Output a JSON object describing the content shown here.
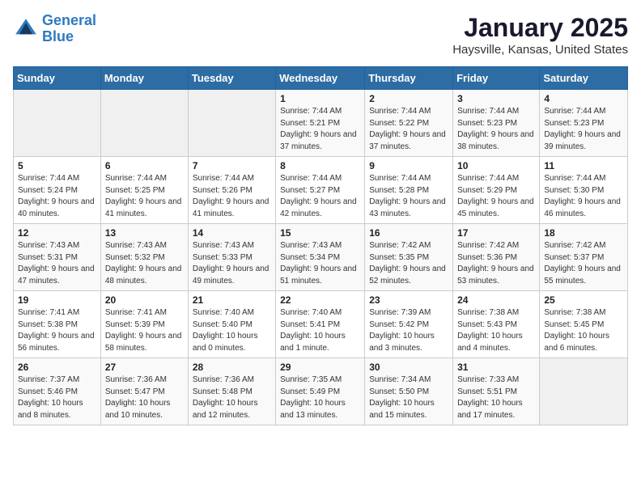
{
  "header": {
    "logo_line1": "General",
    "logo_line2": "Blue",
    "title": "January 2025",
    "subtitle": "Haysville, Kansas, United States"
  },
  "weekdays": [
    "Sunday",
    "Monday",
    "Tuesday",
    "Wednesday",
    "Thursday",
    "Friday",
    "Saturday"
  ],
  "weeks": [
    [
      {
        "day": "",
        "info": ""
      },
      {
        "day": "",
        "info": ""
      },
      {
        "day": "",
        "info": ""
      },
      {
        "day": "1",
        "info": "Sunrise: 7:44 AM\nSunset: 5:21 PM\nDaylight: 9 hours and 37 minutes."
      },
      {
        "day": "2",
        "info": "Sunrise: 7:44 AM\nSunset: 5:22 PM\nDaylight: 9 hours and 37 minutes."
      },
      {
        "day": "3",
        "info": "Sunrise: 7:44 AM\nSunset: 5:23 PM\nDaylight: 9 hours and 38 minutes."
      },
      {
        "day": "4",
        "info": "Sunrise: 7:44 AM\nSunset: 5:23 PM\nDaylight: 9 hours and 39 minutes."
      }
    ],
    [
      {
        "day": "5",
        "info": "Sunrise: 7:44 AM\nSunset: 5:24 PM\nDaylight: 9 hours and 40 minutes."
      },
      {
        "day": "6",
        "info": "Sunrise: 7:44 AM\nSunset: 5:25 PM\nDaylight: 9 hours and 41 minutes."
      },
      {
        "day": "7",
        "info": "Sunrise: 7:44 AM\nSunset: 5:26 PM\nDaylight: 9 hours and 41 minutes."
      },
      {
        "day": "8",
        "info": "Sunrise: 7:44 AM\nSunset: 5:27 PM\nDaylight: 9 hours and 42 minutes."
      },
      {
        "day": "9",
        "info": "Sunrise: 7:44 AM\nSunset: 5:28 PM\nDaylight: 9 hours and 43 minutes."
      },
      {
        "day": "10",
        "info": "Sunrise: 7:44 AM\nSunset: 5:29 PM\nDaylight: 9 hours and 45 minutes."
      },
      {
        "day": "11",
        "info": "Sunrise: 7:44 AM\nSunset: 5:30 PM\nDaylight: 9 hours and 46 minutes."
      }
    ],
    [
      {
        "day": "12",
        "info": "Sunrise: 7:43 AM\nSunset: 5:31 PM\nDaylight: 9 hours and 47 minutes."
      },
      {
        "day": "13",
        "info": "Sunrise: 7:43 AM\nSunset: 5:32 PM\nDaylight: 9 hours and 48 minutes."
      },
      {
        "day": "14",
        "info": "Sunrise: 7:43 AM\nSunset: 5:33 PM\nDaylight: 9 hours and 49 minutes."
      },
      {
        "day": "15",
        "info": "Sunrise: 7:43 AM\nSunset: 5:34 PM\nDaylight: 9 hours and 51 minutes."
      },
      {
        "day": "16",
        "info": "Sunrise: 7:42 AM\nSunset: 5:35 PM\nDaylight: 9 hours and 52 minutes."
      },
      {
        "day": "17",
        "info": "Sunrise: 7:42 AM\nSunset: 5:36 PM\nDaylight: 9 hours and 53 minutes."
      },
      {
        "day": "18",
        "info": "Sunrise: 7:42 AM\nSunset: 5:37 PM\nDaylight: 9 hours and 55 minutes."
      }
    ],
    [
      {
        "day": "19",
        "info": "Sunrise: 7:41 AM\nSunset: 5:38 PM\nDaylight: 9 hours and 56 minutes."
      },
      {
        "day": "20",
        "info": "Sunrise: 7:41 AM\nSunset: 5:39 PM\nDaylight: 9 hours and 58 minutes."
      },
      {
        "day": "21",
        "info": "Sunrise: 7:40 AM\nSunset: 5:40 PM\nDaylight: 10 hours and 0 minutes."
      },
      {
        "day": "22",
        "info": "Sunrise: 7:40 AM\nSunset: 5:41 PM\nDaylight: 10 hours and 1 minute."
      },
      {
        "day": "23",
        "info": "Sunrise: 7:39 AM\nSunset: 5:42 PM\nDaylight: 10 hours and 3 minutes."
      },
      {
        "day": "24",
        "info": "Sunrise: 7:38 AM\nSunset: 5:43 PM\nDaylight: 10 hours and 4 minutes."
      },
      {
        "day": "25",
        "info": "Sunrise: 7:38 AM\nSunset: 5:45 PM\nDaylight: 10 hours and 6 minutes."
      }
    ],
    [
      {
        "day": "26",
        "info": "Sunrise: 7:37 AM\nSunset: 5:46 PM\nDaylight: 10 hours and 8 minutes."
      },
      {
        "day": "27",
        "info": "Sunrise: 7:36 AM\nSunset: 5:47 PM\nDaylight: 10 hours and 10 minutes."
      },
      {
        "day": "28",
        "info": "Sunrise: 7:36 AM\nSunset: 5:48 PM\nDaylight: 10 hours and 12 minutes."
      },
      {
        "day": "29",
        "info": "Sunrise: 7:35 AM\nSunset: 5:49 PM\nDaylight: 10 hours and 13 minutes."
      },
      {
        "day": "30",
        "info": "Sunrise: 7:34 AM\nSunset: 5:50 PM\nDaylight: 10 hours and 15 minutes."
      },
      {
        "day": "31",
        "info": "Sunrise: 7:33 AM\nSunset: 5:51 PM\nDaylight: 10 hours and 17 minutes."
      },
      {
        "day": "",
        "info": ""
      }
    ]
  ]
}
